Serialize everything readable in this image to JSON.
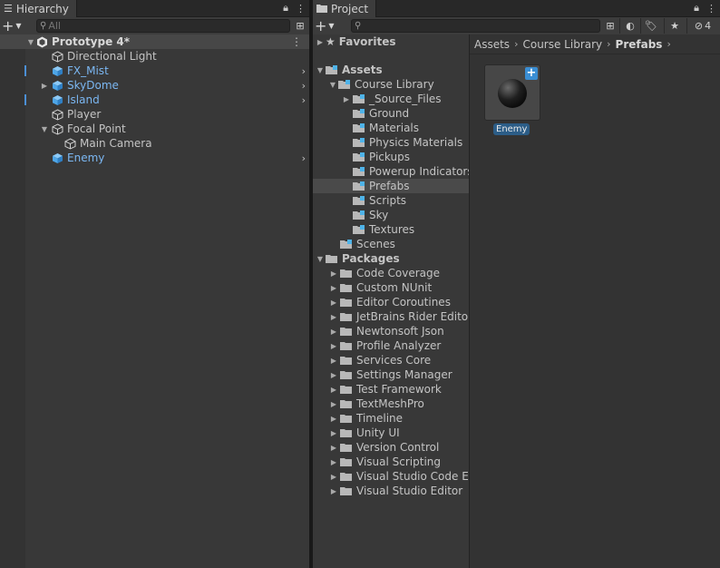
{
  "hierarchy": {
    "tab_title": "Hierarchy",
    "search_placeholder": "All",
    "scene_name": "Prototype 4*",
    "items": [
      {
        "label": "Directional Light"
      },
      {
        "label": "FX_Mist"
      },
      {
        "label": "SkyDome"
      },
      {
        "label": "Island"
      },
      {
        "label": "Player"
      },
      {
        "label": "Focal Point"
      },
      {
        "label": "Main Camera"
      },
      {
        "label": "Enemy"
      }
    ]
  },
  "project": {
    "tab_title": "Project",
    "search_value": "",
    "hidden_count": "4",
    "favorites": "Favorites",
    "assets": "Assets",
    "course_library": "Course Library",
    "course_children": [
      "_Source_Files",
      "Ground",
      "Materials",
      "Physics Materials",
      "Pickups",
      "Powerup Indicators",
      "Prefabs",
      "Scripts",
      "Sky",
      "Textures"
    ],
    "scenes": "Scenes",
    "packages": "Packages",
    "package_children": [
      "Code Coverage",
      "Custom NUnit",
      "Editor Coroutines",
      "JetBrains Rider Editor",
      "Newtonsoft Json",
      "Profile Analyzer",
      "Services Core",
      "Settings Manager",
      "Test Framework",
      "TextMeshPro",
      "Timeline",
      "Unity UI",
      "Version Control",
      "Visual Scripting",
      "Visual Studio Code Ed",
      "Visual Studio Editor"
    ],
    "breadcrumb": [
      "Assets",
      "Course Library",
      "Prefabs"
    ],
    "grid_item": "Enemy"
  },
  "colors": {
    "accent": "#2c5d87",
    "prefab_blue": "#7bb7f2"
  }
}
